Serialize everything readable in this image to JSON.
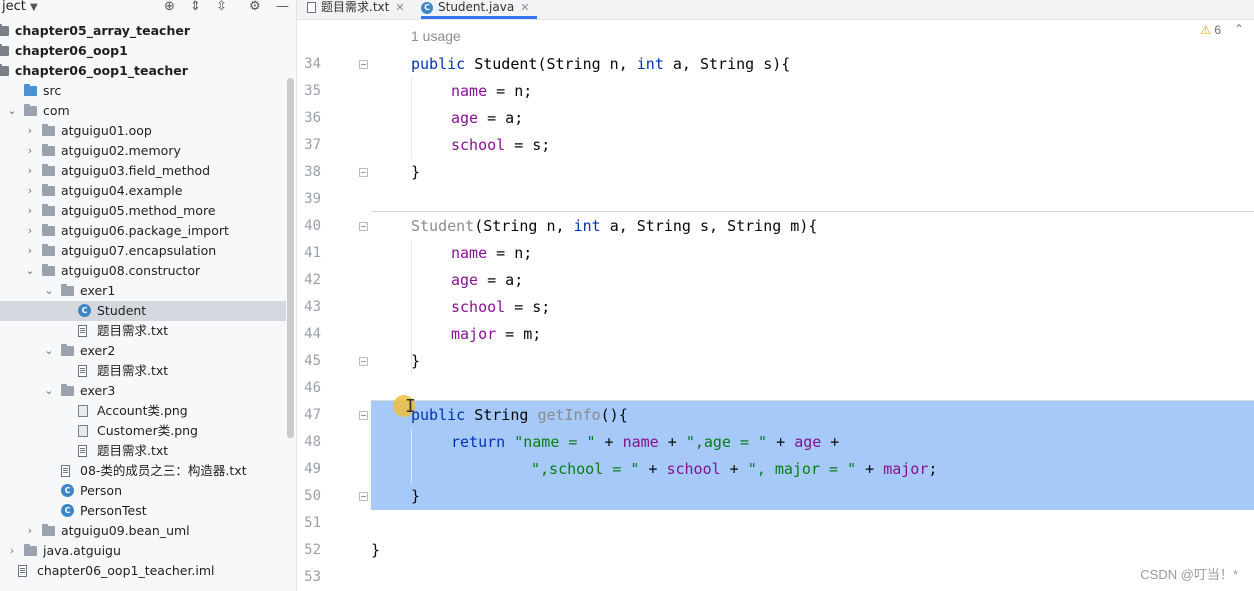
{
  "project_panel": {
    "header_label": "ject",
    "header_menu_icon": "chevron-down-icon",
    "toolbar_icons": [
      "locate-icon",
      "expand-all-icon",
      "collapse-all-icon",
      "gear-icon",
      "minimize-icon"
    ],
    "items": [
      {
        "label": "chapter05_array_teacher",
        "icon": "module",
        "bold": true
      },
      {
        "label": "chapter06_oop1",
        "icon": "module",
        "bold": true
      },
      {
        "label": "chapter06_oop1_teacher",
        "icon": "module",
        "bold": true
      },
      {
        "label": "src",
        "icon": "src-folder"
      },
      {
        "label": "com",
        "icon": "package",
        "expanded": true
      },
      {
        "label": "atguigu01.oop",
        "icon": "package"
      },
      {
        "label": "atguigu02.memory",
        "icon": "package"
      },
      {
        "label": "atguigu03.field_method",
        "icon": "package"
      },
      {
        "label": "atguigu04.example",
        "icon": "package"
      },
      {
        "label": "atguigu05.method_more",
        "icon": "package"
      },
      {
        "label": "atguigu06.package_import",
        "icon": "package"
      },
      {
        "label": "atguigu07.encapsulation",
        "icon": "package"
      },
      {
        "label": "atguigu08.constructor",
        "icon": "package",
        "expanded": true
      },
      {
        "label": "exer1",
        "icon": "package",
        "expanded": true
      },
      {
        "label": "Student",
        "icon": "class",
        "selected": true
      },
      {
        "label": "题目需求.txt",
        "icon": "text-file"
      },
      {
        "label": "exer2",
        "icon": "package",
        "expanded": true
      },
      {
        "label": "题目需求.txt",
        "icon": "text-file"
      },
      {
        "label": "exer3",
        "icon": "package",
        "expanded": true
      },
      {
        "label": "Account类.png",
        "icon": "image-file"
      },
      {
        "label": "Customer类.png",
        "icon": "image-file"
      },
      {
        "label": "题目需求.txt",
        "icon": "text-file"
      },
      {
        "label": "08-类的成员之三：构造器.txt",
        "icon": "text-file"
      },
      {
        "label": "Person",
        "icon": "class"
      },
      {
        "label": "PersonTest",
        "icon": "class"
      },
      {
        "label": "atguigu09.bean_uml",
        "icon": "package"
      },
      {
        "label": "java.atguigu",
        "icon": "package"
      },
      {
        "label": "chapter06_oop1_teacher.iml",
        "icon": "text-file"
      }
    ]
  },
  "tabs": [
    {
      "label": "题目需求.txt",
      "icon": "text-file-icon",
      "active": false
    },
    {
      "label": "Student.java",
      "icon": "class-icon",
      "active": true
    }
  ],
  "editor": {
    "warnings": {
      "icon": "warning-icon",
      "count": "6"
    },
    "usage_hint": "1 usage",
    "line_numbers": [
      "34",
      "35",
      "36",
      "37",
      "38",
      "39",
      "40",
      "41",
      "42",
      "43",
      "44",
      "45",
      "46",
      "47",
      "48",
      "49",
      "50",
      "51",
      "52",
      "53"
    ],
    "lines": [
      {
        "n": "34",
        "t": [
          [
            "kw",
            "public "
          ],
          [
            "tp",
            "Student"
          ],
          [
            "",
            "(String n, "
          ],
          [
            "kw",
            "int "
          ],
          [
            "",
            "a, String s){"
          ]
        ]
      },
      {
        "n": "35",
        "t": [
          [
            "fld",
            "name"
          ],
          [
            "",
            " = n;"
          ]
        ]
      },
      {
        "n": "36",
        "t": [
          [
            "fld",
            "age"
          ],
          [
            "",
            " = a;"
          ]
        ]
      },
      {
        "n": "37",
        "t": [
          [
            "fld",
            "school"
          ],
          [
            "",
            " = s;"
          ]
        ]
      },
      {
        "n": "38",
        "t": [
          [
            "",
            "}"
          ]
        ]
      },
      {
        "n": "39",
        "t": []
      },
      {
        "n": "40",
        "t": [
          [
            "grey",
            "Student"
          ],
          [
            "",
            "(String n, "
          ],
          [
            "kw",
            "int "
          ],
          [
            "",
            "a, String s, String m){"
          ]
        ]
      },
      {
        "n": "41",
        "t": [
          [
            "fld",
            "name"
          ],
          [
            "",
            " = n;"
          ]
        ]
      },
      {
        "n": "42",
        "t": [
          [
            "fld",
            "age"
          ],
          [
            "",
            " = a;"
          ]
        ]
      },
      {
        "n": "43",
        "t": [
          [
            "fld",
            "school"
          ],
          [
            "",
            " = s;"
          ]
        ]
      },
      {
        "n": "44",
        "t": [
          [
            "fld",
            "major"
          ],
          [
            "",
            " = m;"
          ]
        ]
      },
      {
        "n": "45",
        "t": [
          [
            "",
            "}"
          ]
        ]
      },
      {
        "n": "46",
        "t": []
      },
      {
        "n": "47",
        "t": [
          [
            "kw",
            "public "
          ],
          [
            "",
            "String "
          ],
          [
            "grey",
            "getInfo"
          ],
          [
            "",
            "(){"
          ]
        ]
      },
      {
        "n": "48",
        "t": [
          [
            "kw",
            "return "
          ],
          [
            "str",
            "\"name = \""
          ],
          [
            "",
            " + "
          ],
          [
            "fld",
            "name"
          ],
          [
            "",
            " + "
          ],
          [
            "str",
            "\",age = \""
          ],
          [
            "",
            " + "
          ],
          [
            "fld",
            "age"
          ],
          [
            "",
            " +"
          ]
        ]
      },
      {
        "n": "49",
        "t": [
          [
            "str",
            "\",school = \""
          ],
          [
            "",
            " + "
          ],
          [
            "fld",
            "school"
          ],
          [
            "",
            " + "
          ],
          [
            "str",
            "\", major = \""
          ],
          [
            "",
            " + "
          ],
          [
            "fld",
            "major"
          ],
          [
            ";",
            ";"
          ]
        ]
      },
      {
        "n": "50",
        "t": [
          [
            "",
            "}"
          ]
        ]
      },
      {
        "n": "51",
        "t": []
      },
      {
        "n": "52",
        "t": [
          [
            "",
            "}"
          ]
        ]
      },
      {
        "n": "53",
        "t": []
      }
    ]
  },
  "watermark": "CSDN @叮当！*"
}
